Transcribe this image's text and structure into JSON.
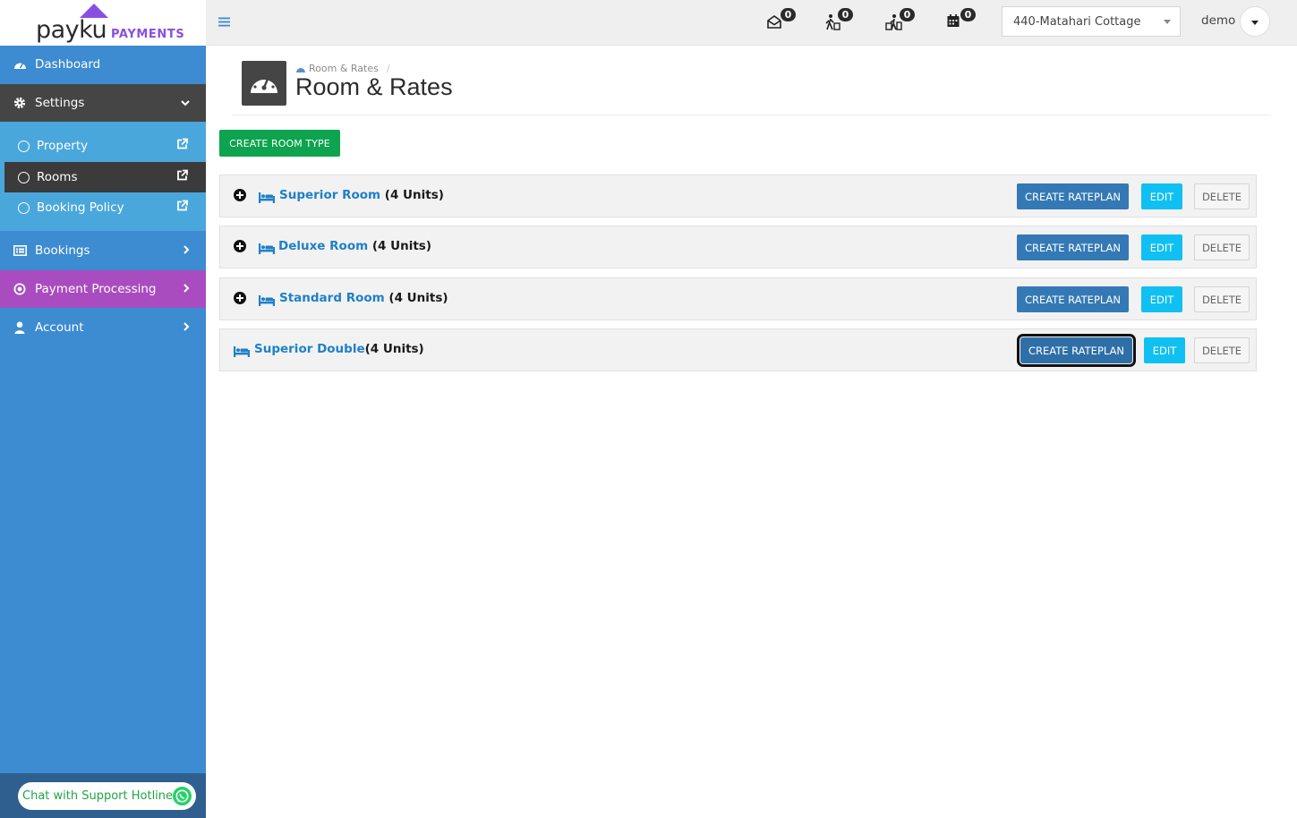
{
  "brand": {
    "name": "payku",
    "sub": "PAYMENTS"
  },
  "sidebar": {
    "dashboard": "Dashboard",
    "settings": "Settings",
    "settings_sub": [
      "Property",
      "Rooms",
      "Booking Policy"
    ],
    "bookings": "Bookings",
    "payment": "Payment Processing",
    "account": "Account",
    "support": "Chat with Support Hotline"
  },
  "topbar": {
    "notifications": {
      "mail": "0",
      "checkin": "0",
      "checkout": "0",
      "calendar": "0"
    },
    "property": "440-Matahari Cottage",
    "user": "demo"
  },
  "page": {
    "breadcrumb": "Room & Rates",
    "title": "Room & Rates",
    "create_room_type": "CREATE ROOM TYPE"
  },
  "rooms": [
    {
      "name": "Superior Room",
      "units": " (4 Units)",
      "expandable": true
    },
    {
      "name": "Deluxe Room",
      "units": " (4 Units)",
      "expandable": true
    },
    {
      "name": "Standard Room",
      "units": " (4 Units)",
      "expandable": true
    },
    {
      "name": "Superior Double",
      "units": "(4 Units)",
      "expandable": false
    }
  ],
  "actions": {
    "create_rateplan": "CREATE RATEPLAN",
    "edit": "EDIT",
    "delete": "DELETE"
  },
  "colors": {
    "sidebar": "#3d8bd1",
    "settings_active": "#454545",
    "payment": "#a94cbf",
    "brand_purple": "#8a4fe0",
    "create_green": "#0ea34f",
    "rateplan_blue": "#3479b5",
    "edit_cyan": "#10c0f2",
    "room_link": "#1f80c8"
  }
}
